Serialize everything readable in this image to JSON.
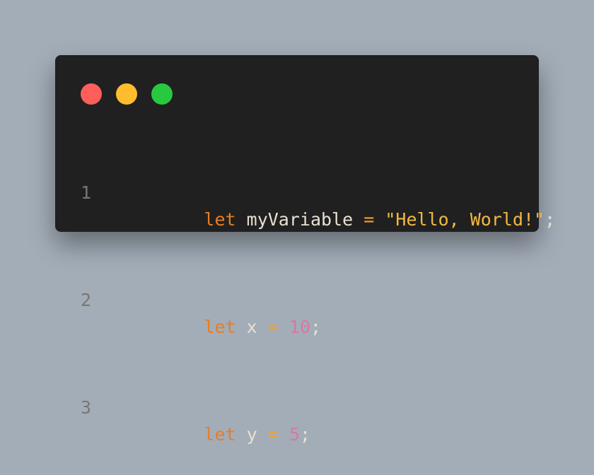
{
  "colors": {
    "background": "#a3adb8",
    "window": "#202020",
    "traffic_red": "#ff5f5b",
    "traffic_yellow": "#ffbd2e",
    "traffic_green": "#27c93f",
    "line_number": "#7b7671",
    "keyword": "#e67e22",
    "identifier": "#e8e0d2",
    "operator": "#f3a22e",
    "string": "#f5b841",
    "number": "#d47aa4"
  },
  "window_controls": [
    {
      "name": "close-dot",
      "icon": "red-circle",
      "color": "#ff5f5b"
    },
    {
      "name": "minimize-dot",
      "icon": "yellow-circle",
      "color": "#ffbd2e"
    },
    {
      "name": "maximize-dot",
      "icon": "green-circle",
      "color": "#27c93f"
    }
  ],
  "code_lines": [
    {
      "number": "1",
      "tokens": [
        {
          "type": "keyword",
          "text": "let"
        },
        {
          "type": "space",
          "text": " "
        },
        {
          "type": "identifier",
          "text": "myVariable"
        },
        {
          "type": "space",
          "text": " "
        },
        {
          "type": "operator",
          "text": "="
        },
        {
          "type": "space",
          "text": " "
        },
        {
          "type": "string",
          "text": "\"Hello, World!\""
        },
        {
          "type": "punct",
          "text": ";"
        }
      ]
    },
    {
      "number": "2",
      "tokens": [
        {
          "type": "keyword",
          "text": "let"
        },
        {
          "type": "space",
          "text": " "
        },
        {
          "type": "identifier",
          "text": "x"
        },
        {
          "type": "space",
          "text": " "
        },
        {
          "type": "operator",
          "text": "="
        },
        {
          "type": "space",
          "text": " "
        },
        {
          "type": "number",
          "text": "10"
        },
        {
          "type": "punct",
          "text": ";"
        }
      ]
    },
    {
      "number": "3",
      "tokens": [
        {
          "type": "keyword",
          "text": "let"
        },
        {
          "type": "space",
          "text": " "
        },
        {
          "type": "identifier",
          "text": "y"
        },
        {
          "type": "space",
          "text": " "
        },
        {
          "type": "operator",
          "text": "="
        },
        {
          "type": "space",
          "text": " "
        },
        {
          "type": "number",
          "text": "5"
        },
        {
          "type": "punct",
          "text": ";"
        }
      ]
    }
  ]
}
